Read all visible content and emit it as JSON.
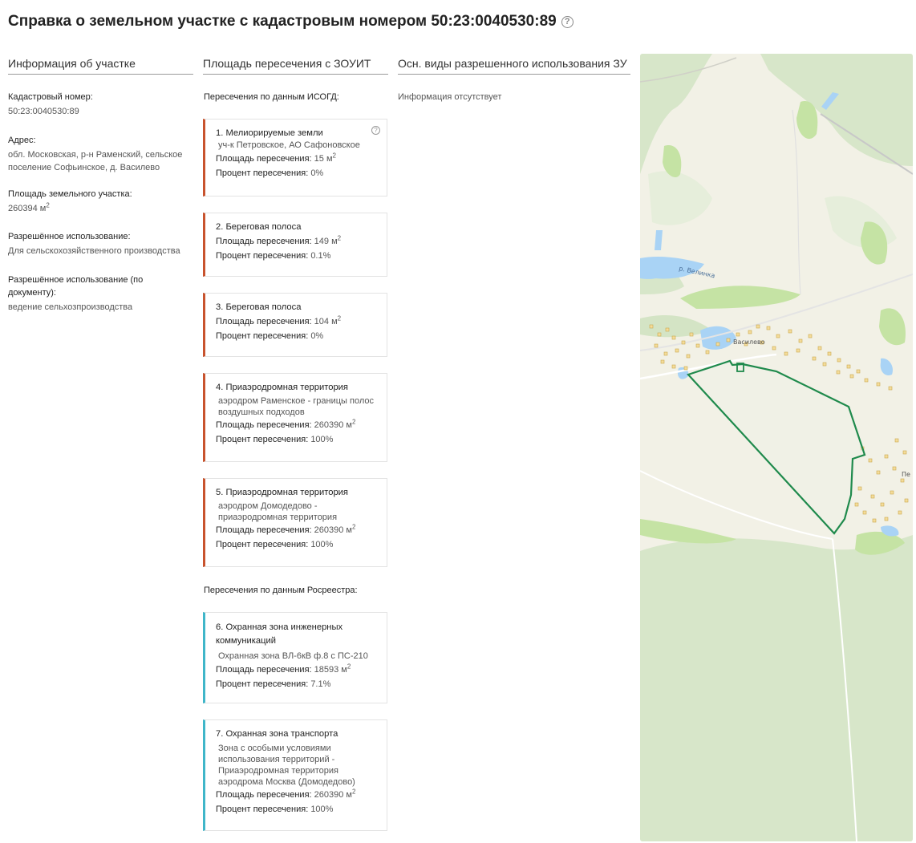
{
  "page": {
    "title": "Справка о земельном участке с кадастровым номером 50:23:0040530:89"
  },
  "columns": {
    "info": "Информация об участке",
    "intersections": "Площадь пересечения с ЗОУИТ",
    "permitted_use": "Осн. виды разрешенного использования ЗУ"
  },
  "info": {
    "cadastral_label": "Кадастровый номер:",
    "cadastral_value": "50:23:0040530:89",
    "address_label": "Адрес:",
    "address_value": "обл. Московская, р-н Раменский, сельское поселение Софьинское, д. Василево",
    "area_label": "Площадь земельного участка:",
    "area_value": "260394 м",
    "area_unit_sup": "2",
    "use_label": "Разрешённое использование:",
    "use_value": "Для сельскохозяйственного производства",
    "doc_use_label": "Разрешённое использование (по документу):",
    "doc_use_value": "ведение сельхозпроизводства"
  },
  "isogd_label": "Пересечения по данным ИСОГД:",
  "rosreestr_label": "Пересечения по данным Росреестра:",
  "cards": [
    {
      "title": "1. Мелиорируемые земли",
      "sub": "уч-к Петровское, АО Сафоновское",
      "area_label": "Площадь пересечения:",
      "area": "15 м",
      "sup": "2",
      "pct_label": "Процент пересечения:",
      "pct": "0%"
    },
    {
      "title": "2. Береговая полоса",
      "sub": "",
      "area_label": "Площадь пересечения:",
      "area": "149 м",
      "sup": "2",
      "pct_label": "Процент пересечения:",
      "pct": "0.1%"
    },
    {
      "title": "3. Береговая полоса",
      "sub": "",
      "area_label": "Площадь пересечения:",
      "area": "104 м",
      "sup": "2",
      "pct_label": "Процент пересечения:",
      "pct": "0%"
    },
    {
      "title": "4. Приаэродромная территория",
      "sub": "аэродром Раменское - границы полос воздушных подходов",
      "area_label": "Площадь пересечения:",
      "area": "260390 м",
      "sup": "2",
      "pct_label": "Процент пересечения:",
      "pct": "100%"
    },
    {
      "title": "5. Приаэродромная территория",
      "sub": "аэродром Домодедово - приаэродромная территория",
      "area_label": "Площадь пересечения:",
      "area": "260390 м",
      "sup": "2",
      "pct_label": "Процент пересечения:",
      "pct": "100%"
    },
    {
      "title": "6. Охранная зона инженерных коммуникаций",
      "sub": "Охранная зона ВЛ-6кВ ф.8 с ПС-210",
      "area_label": "Площадь пересечения:",
      "area": "18593 м",
      "sup": "2",
      "pct_label": "Процент пересечения:",
      "pct": "7.1%"
    },
    {
      "title": "7. Охранная зона транспорта",
      "sub": "Зона с особыми условиями использования территорий - Приаэродромная территория аэродрома Москва (Домодедово)",
      "area_label": "Площадь пересечения:",
      "area": "260390 м",
      "sup": "2",
      "pct_label": "Процент пересечения:",
      "pct": "100%"
    }
  ],
  "permitted_use_text": "Информация отсутствует",
  "map": {
    "river_label": "р. Велинка",
    "village_label": "Василево",
    "edge_label": "Пе",
    "parcel_color": "#1f8a4c"
  }
}
